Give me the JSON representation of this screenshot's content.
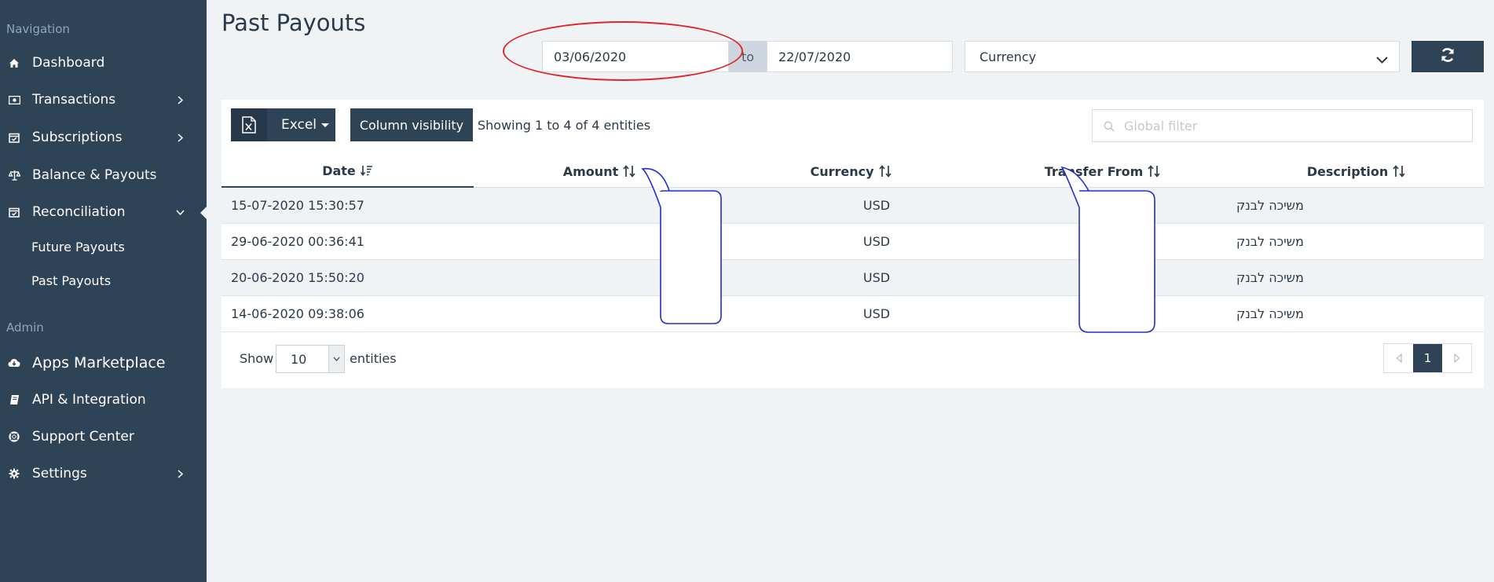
{
  "sidebar": {
    "section_navigation": "Navigation",
    "section_admin": "Admin",
    "items": [
      {
        "label": "Dashboard",
        "icon": "home-icon"
      },
      {
        "label": "Transactions",
        "icon": "money-icon"
      },
      {
        "label": "Subscriptions",
        "icon": "calendar-check-icon"
      },
      {
        "label": "Balance & Payouts",
        "icon": "scale-icon"
      },
      {
        "label": "Reconciliation",
        "icon": "calendar-check-icon"
      },
      {
        "label": "Apps Marketplace",
        "icon": "cloud-download-icon"
      },
      {
        "label": "API & Integration",
        "icon": "book-icon"
      },
      {
        "label": "Support Center",
        "icon": "life-ring-icon"
      },
      {
        "label": "Settings",
        "icon": "gear-icon"
      }
    ],
    "sub_items": [
      {
        "label": "Future Payouts"
      },
      {
        "label": "Past Payouts"
      }
    ]
  },
  "page": {
    "title": "Past Payouts"
  },
  "filters": {
    "date_from": "03/06/2020",
    "date_separator": "to",
    "date_to": "22/07/2020",
    "currency_placeholder": "Currency"
  },
  "toolbar": {
    "excel_label": "Excel",
    "column_visibility_label": "Column visibility",
    "showing_info": "Showing 1 to 4 of 4 entities",
    "global_filter_placeholder": "Global filter"
  },
  "table": {
    "columns": [
      "Date",
      "Amount",
      "Currency",
      "Transfer From",
      "Description"
    ],
    "rows": [
      {
        "date": "15-07-2020 15:30:57",
        "amount": "",
        "currency": "USD",
        "transfer_from": "",
        "description": "משיכה לבנק"
      },
      {
        "date": "29-06-2020 00:36:41",
        "amount": "",
        "currency": "USD",
        "transfer_from": "",
        "description": "משיכה לבנק"
      },
      {
        "date": "20-06-2020 15:50:20",
        "amount": "",
        "currency": "USD",
        "transfer_from": "",
        "description": "משיכה לבנק"
      },
      {
        "date": "14-06-2020 09:38:06",
        "amount": "",
        "currency": "USD",
        "transfer_from": "",
        "description": "משיכה לבנק"
      }
    ]
  },
  "footer": {
    "show_label": "Show",
    "page_size": "10",
    "entities_label": "entities",
    "current_page": "1"
  },
  "colors": {
    "sidebar_bg": "#2f4356",
    "page_bg": "#f0f3f6",
    "annotation_red": "#e0262a",
    "annotation_blue": "#1f2fd6"
  }
}
